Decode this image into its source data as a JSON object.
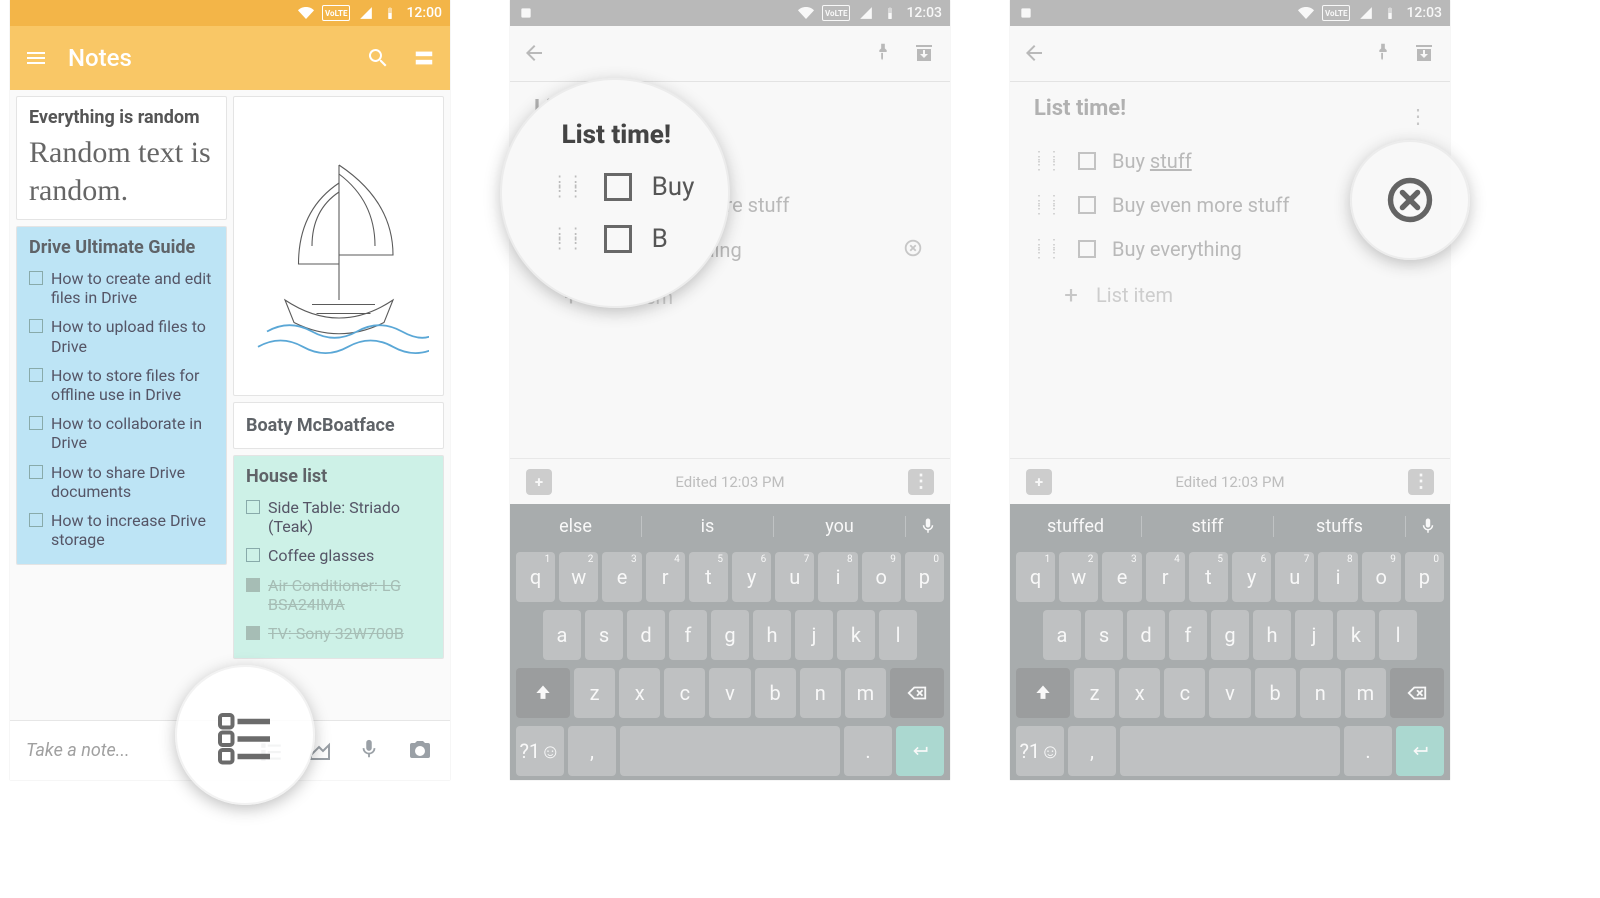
{
  "status": {
    "time1": "12:00",
    "time2": "12:03",
    "time3": "12:03",
    "volte": "VoLTE"
  },
  "screen1": {
    "title": "Notes",
    "take_note": "Take a note...",
    "card_random": {
      "title": "Everything is random",
      "body": "Random text is random."
    },
    "card_boat": {
      "title": "Boaty McBoatface"
    },
    "card_drive": {
      "title": "Drive Ultimate Guide",
      "items": [
        "How to create and edit files in Drive",
        "How to upload files to Drive",
        "How to store files for offline use in Drive",
        "How to collaborate in Drive",
        "How to share Drive documents",
        "How to increase Drive storage"
      ]
    },
    "card_house": {
      "title": "House list",
      "items": [
        {
          "t": "Side Table: Striado (Teak)",
          "done": false
        },
        {
          "t": "Coffee glasses",
          "done": false
        },
        {
          "t": "Air Conditioner: LG BSA24IMA",
          "done": true
        },
        {
          "t": "TV: Sony 32W700B",
          "done": true
        }
      ]
    }
  },
  "screen2": {
    "title": "List time!",
    "items": [
      "Buy stuff",
      "Buy even more stuff",
      "Buy everything"
    ],
    "add_placeholder": "List item",
    "edited": "Edited 12:03 PM",
    "suggestions": [
      "else",
      "is",
      "you"
    ]
  },
  "screen3": {
    "title": "List time!",
    "items": [
      {
        "t": "Buy stuff",
        "under": "stuff"
      },
      {
        "t": "Buy even more stuff"
      },
      {
        "t": "Buy everything"
      }
    ],
    "add_placeholder": "List item",
    "edited": "Edited 12:03 PM",
    "suggestions": [
      "stuffed",
      "stiff",
      "stuffs"
    ]
  },
  "keyboard": {
    "row1": [
      "q",
      "w",
      "e",
      "r",
      "t",
      "y",
      "u",
      "i",
      "o",
      "p"
    ],
    "row1nums": [
      "1",
      "2",
      "3",
      "4",
      "5",
      "6",
      "7",
      "8",
      "9",
      "0"
    ],
    "row2": [
      "a",
      "s",
      "d",
      "f",
      "g",
      "h",
      "j",
      "k",
      "l"
    ],
    "row3": [
      "z",
      "x",
      "c",
      "v",
      "b",
      "n",
      "m"
    ],
    "sym": "?1☺",
    "comma": ",",
    "period": "."
  }
}
